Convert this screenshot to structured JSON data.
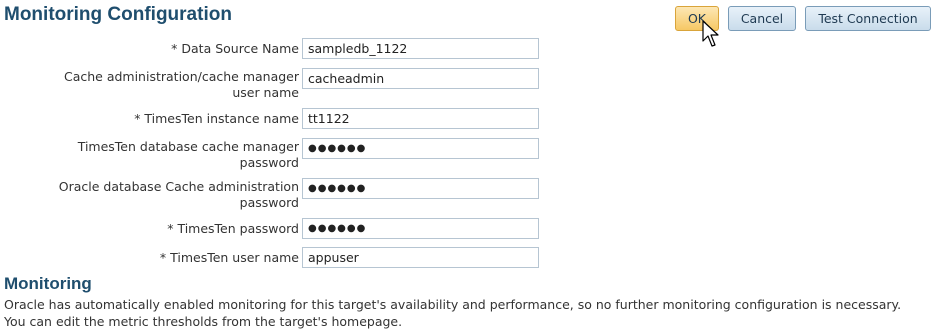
{
  "header": {
    "title": "Monitoring Configuration"
  },
  "buttons": {
    "ok": "OK",
    "cancel": "Cancel",
    "test": "Test Connection"
  },
  "fields": [
    {
      "label": "* Data Source Name",
      "value": "sampledb_1122"
    },
    {
      "label_line1": "Cache administration/cache manager",
      "label_line2": "user name",
      "value": "cacheadmin"
    },
    {
      "label": "* TimesTen instance name",
      "value": "tt1122"
    },
    {
      "label_line1": "TimesTen database cache manager",
      "label_line2": "password",
      "value": "●●●●●●"
    },
    {
      "label_line1": "Oracle database Cache administration",
      "label_line2": "password",
      "value": "●●●●●●"
    },
    {
      "label": "* TimesTen password",
      "value": "●●●●●●"
    },
    {
      "label": "* TimesTen user name",
      "value": "appuser"
    }
  ],
  "monitoring": {
    "title": "Monitoring",
    "note": "Oracle has automatically enabled monitoring for this target's availability and performance, so no further monitoring configuration is necessary. You can edit the metric thresholds from the target's homepage."
  },
  "icons": {
    "cursor": "mouse-pointer-icon"
  },
  "colors": {
    "title": "#1f4e6e",
    "ok_button": "#f6c865",
    "button": "#c9dceb"
  }
}
